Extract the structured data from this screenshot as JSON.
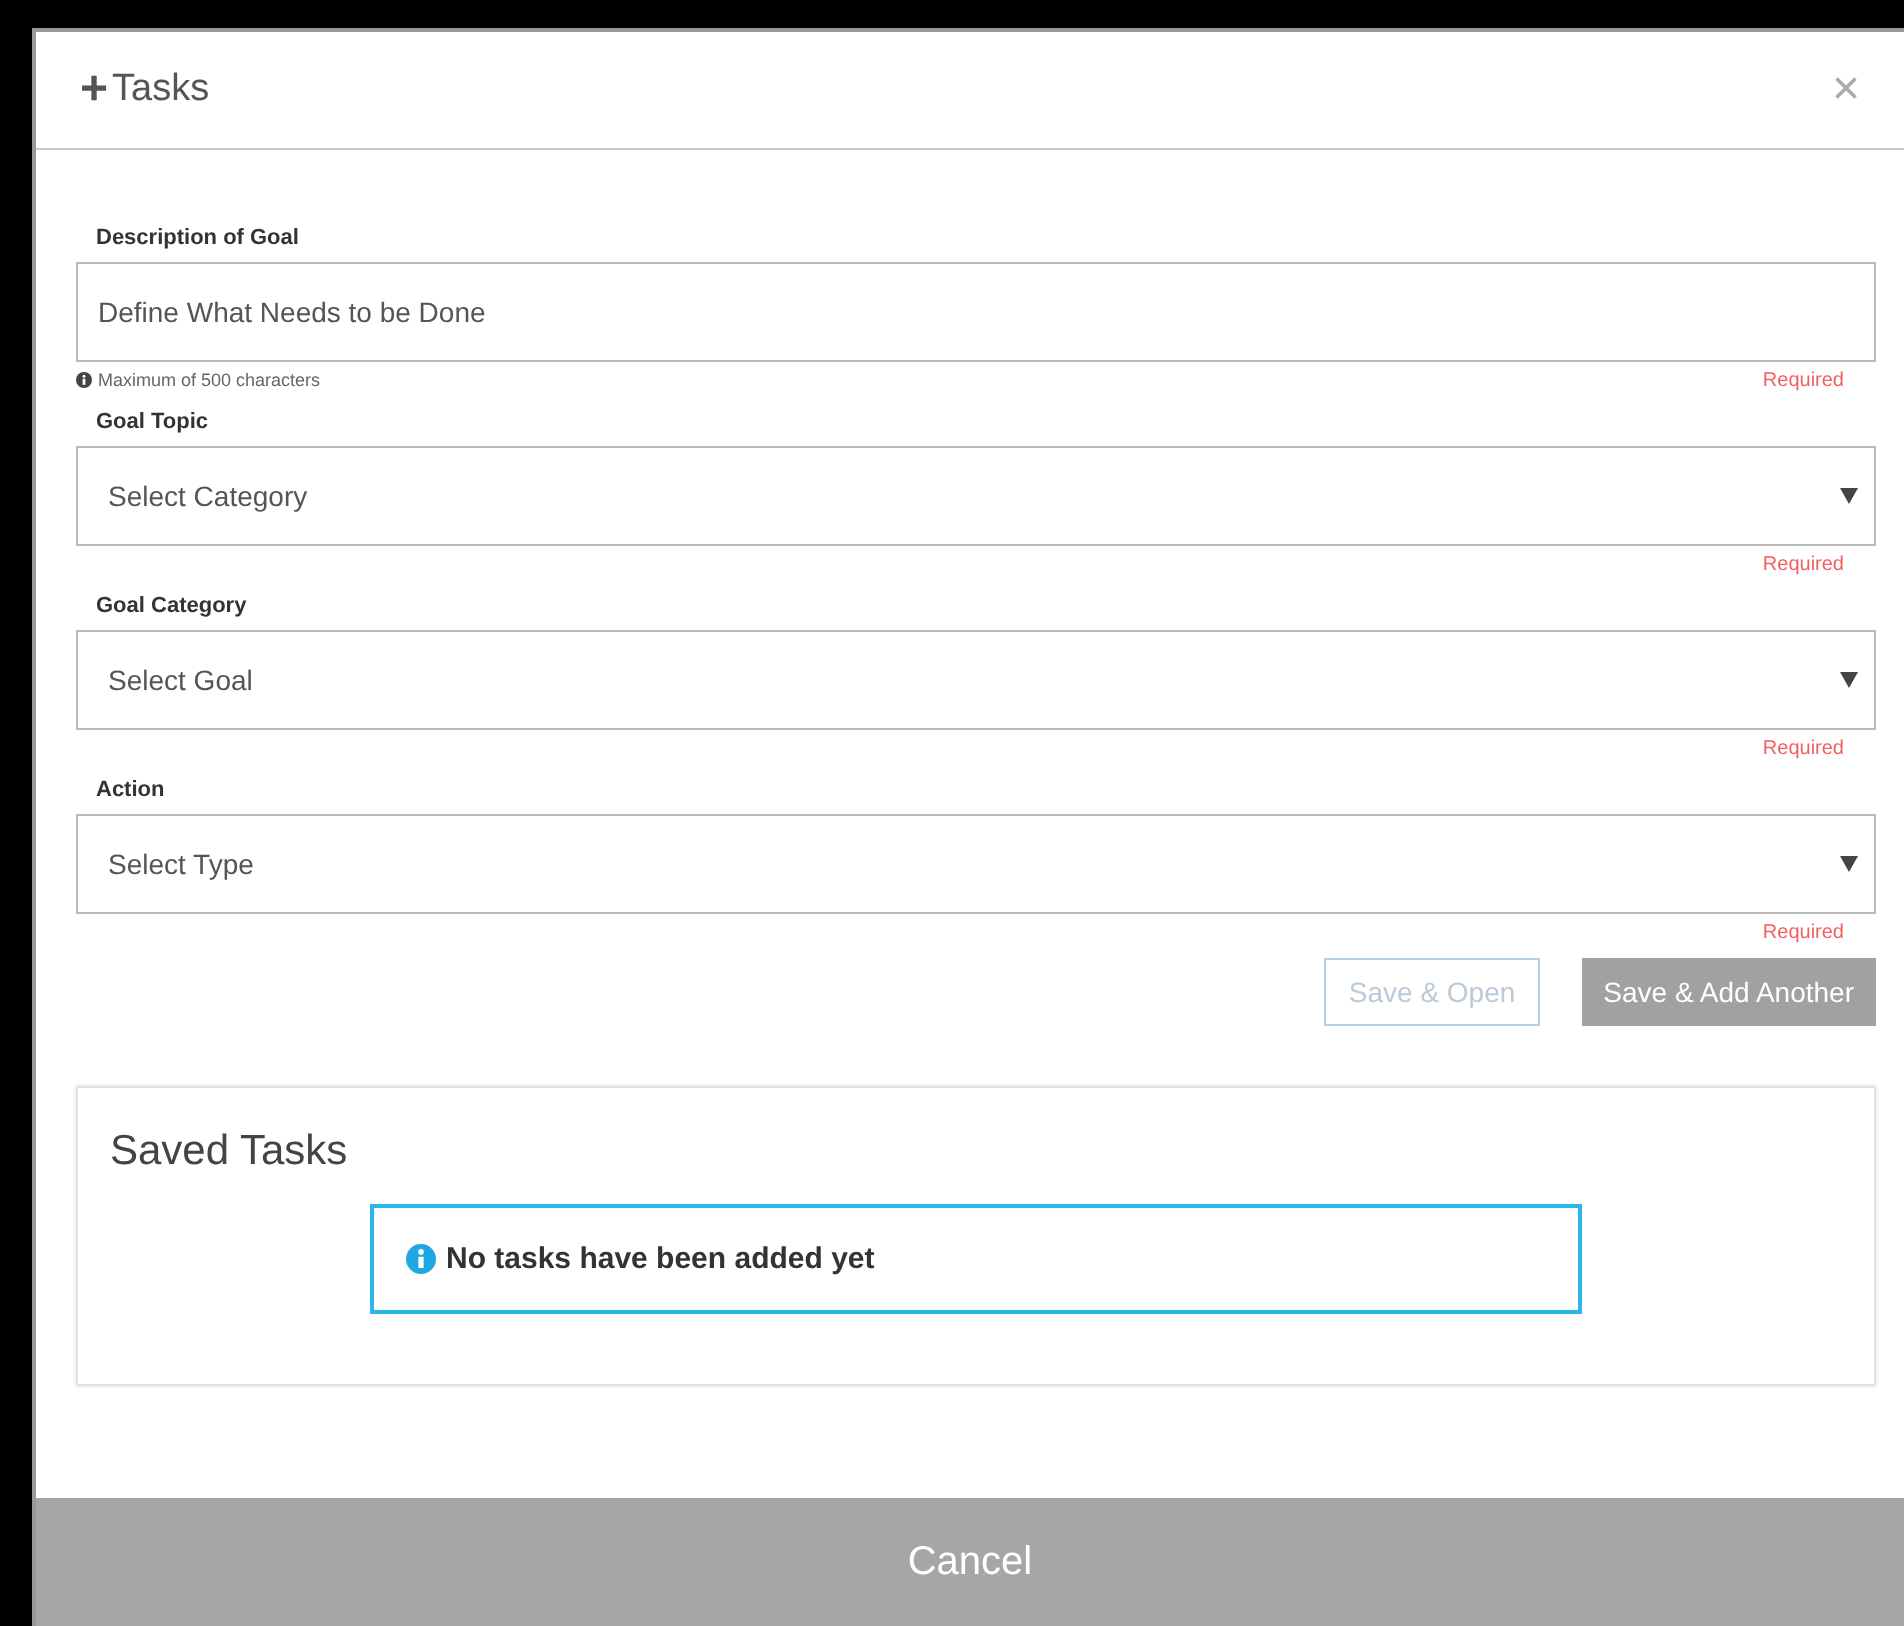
{
  "dialog": {
    "title_icon": "+",
    "title": "Tasks",
    "close": "×"
  },
  "fields": [
    {
      "kind": "text",
      "label": "Description of Goal",
      "placeholder": "Define What Needs to be Done",
      "hint": "Maximum of 500 characters",
      "required": "Required"
    },
    {
      "kind": "select",
      "label": "Goal Topic",
      "placeholder": "Select Category",
      "required": "Required"
    },
    {
      "kind": "select",
      "label": "Goal Category",
      "placeholder": "Select Goal",
      "required": "Required"
    },
    {
      "kind": "select",
      "label": "Action",
      "placeholder": "Select Type",
      "required": "Required"
    }
  ],
  "buttons": [
    {
      "kind": "outline",
      "label": "Save & Open",
      "disabled": true
    },
    {
      "kind": "solid",
      "label": "Save & Add Another",
      "disabled": true
    }
  ],
  "saved_tasks": {
    "title": "Saved Tasks",
    "message": "No tasks have been added yet"
  },
  "footer": {
    "cancel": "Cancel"
  }
}
